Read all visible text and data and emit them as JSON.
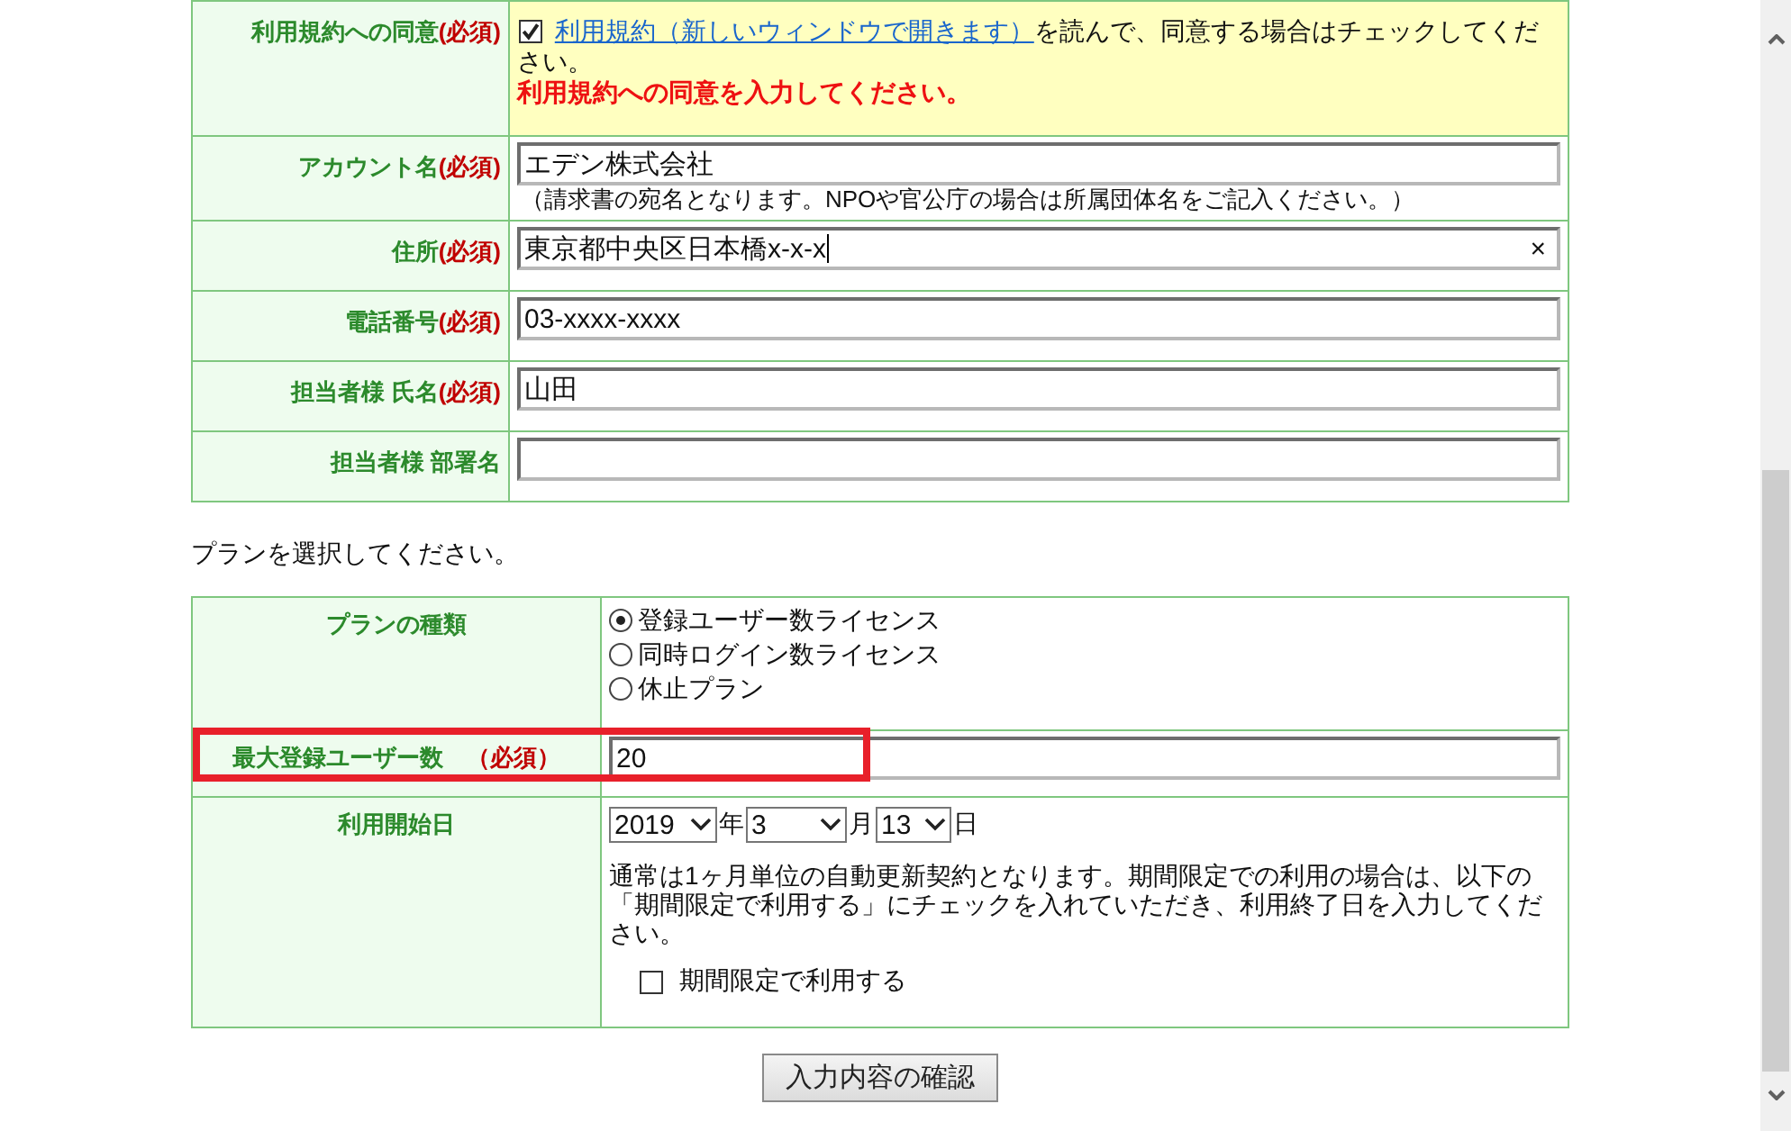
{
  "account_form": {
    "rows": [
      {
        "kind": "agreement",
        "label": "利用規約への同意",
        "required_mark": "(必須)",
        "checked": true,
        "link": "利用規約（新しいウィンドウで開きます）",
        "text": "を読んで、同意する場合はチェックしてください。",
        "error": "利用規約への同意を入力してください。"
      },
      {
        "kind": "input",
        "label": "アカウント名",
        "required_mark": "(必須)",
        "value": "エデン株式会社",
        "note": "（請求書の宛名となります。NPOや官公庁の場合は所属団体名をご記入ください。）"
      },
      {
        "kind": "input",
        "label": "住所",
        "required_mark": "(必須)",
        "value": "東京都中央区日本橋x-x-x",
        "focused": true,
        "clear_button": "×"
      },
      {
        "kind": "input",
        "label": "電話番号",
        "required_mark": "(必須)",
        "value": "03-xxxx-xxxx"
      },
      {
        "kind": "input",
        "label": "担当者様 氏名",
        "required_mark": "(必須)",
        "value": "山田"
      },
      {
        "kind": "input",
        "label": "担当者様 部署名"
      }
    ]
  },
  "plan_prompt": "プランを選択してください。",
  "plan_form": {
    "rows": [
      {
        "kind": "radios",
        "label": "プランの種類",
        "options": [
          {
            "label": "登録ユーザー数ライセンス",
            "selected": true
          },
          {
            "label": "同時ログイン数ライセンス",
            "selected": false
          },
          {
            "label": "休止プラン",
            "selected": false
          }
        ]
      },
      {
        "kind": "input",
        "label": "最大登録ユーザー数　",
        "required_mark": "（必須）",
        "value": "20",
        "highlighted": true
      },
      {
        "kind": "date",
        "label": "利用開始日",
        "year": "2019",
        "year_unit": "年",
        "month": "3",
        "month_unit": "月",
        "day": "13",
        "day_unit": "日",
        "note": "通常は1ヶ月単位の自動更新契約となります。期間限定での利用の場合は、以下の「期間限定で利用する」にチェックを入れていただき、利用終了日を入力してください。",
        "option": {
          "label": "期間限定で利用する",
          "checked": false
        }
      }
    ]
  },
  "confirm_button": "入力内容の確認"
}
